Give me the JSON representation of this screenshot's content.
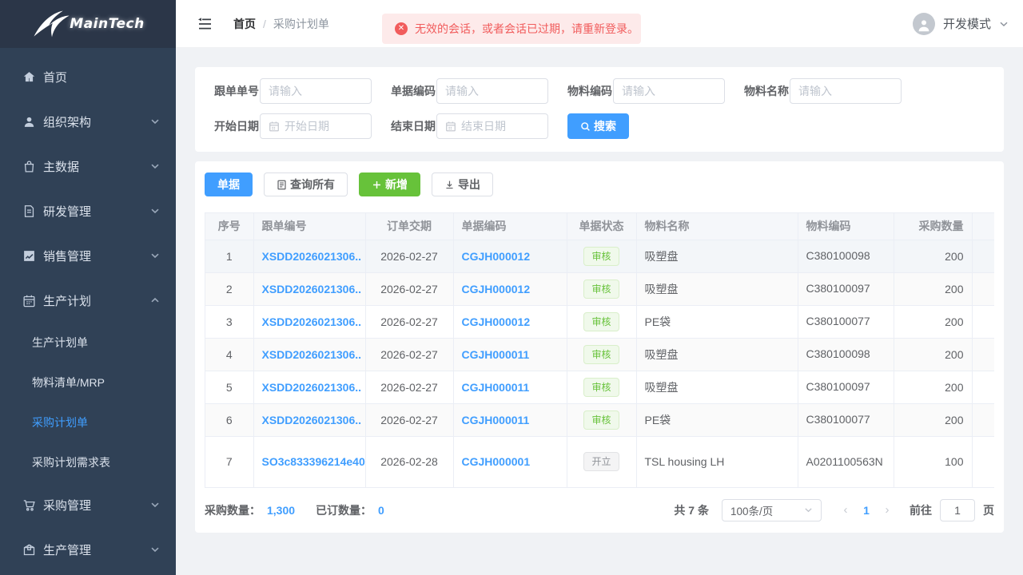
{
  "sidebar": {
    "logo_text": "MainTech",
    "menu": [
      {
        "label": "首页",
        "icon": "home-icon"
      },
      {
        "label": "组织架构",
        "icon": "user-icon",
        "chevron": "down"
      },
      {
        "label": "主数据",
        "icon": "bag-icon",
        "chevron": "down"
      },
      {
        "label": "研发管理",
        "icon": "document-icon",
        "chevron": "down"
      },
      {
        "label": "销售管理",
        "icon": "chart-icon",
        "chevron": "down"
      },
      {
        "label": "生产计划",
        "icon": "calendar-icon",
        "chevron": "up",
        "expanded": true
      },
      {
        "label": "采购管理",
        "icon": "cart-icon",
        "chevron": "down"
      },
      {
        "label": "生产管理",
        "icon": "box-icon",
        "chevron": "down"
      }
    ],
    "production_submenu": [
      {
        "label": "生产计划单",
        "active": false
      },
      {
        "label": "物料清单/MRP",
        "active": false
      },
      {
        "label": "采购计划单",
        "active": true
      },
      {
        "label": "采购计划需求表",
        "active": false
      }
    ]
  },
  "header": {
    "breadcrumb": {
      "home": "首页",
      "separator": "/",
      "current": "采购计划单"
    },
    "alert_text": "无效的会话，或者会话已过期，请重新登录。",
    "user_name": "开发模式"
  },
  "search": {
    "fields": [
      {
        "label": "跟单单号",
        "placeholder": "请输入"
      },
      {
        "label": "单据编码",
        "placeholder": "请输入"
      },
      {
        "label": "物料编码",
        "placeholder": "请输入"
      },
      {
        "label": "物料名称",
        "placeholder": "请输入"
      }
    ],
    "date_fields": [
      {
        "label": "开始日期",
        "placeholder": "开始日期"
      },
      {
        "label": "结束日期",
        "placeholder": "结束日期"
      }
    ],
    "search_button": "搜索"
  },
  "toolbar": {
    "document_button": "单据",
    "query_all_button": "查询所有",
    "add_button": "新增",
    "export_button": "导出"
  },
  "table": {
    "columns": [
      "序号",
      "跟单编号",
      "订单交期",
      "单据编码",
      "单据状态",
      "物料名称",
      "物料编码",
      "采购数量"
    ],
    "rows": [
      {
        "no": "1",
        "order": "XSDD2026021306..",
        "date": "2026-02-27",
        "doc": "CGJH000012",
        "status": "审核",
        "status_type": "success",
        "material": "吸塑盘",
        "code": "C380100098",
        "qty": "200"
      },
      {
        "no": "2",
        "order": "XSDD2026021306..",
        "date": "2026-02-27",
        "doc": "CGJH000012",
        "status": "审核",
        "status_type": "success",
        "material": "吸塑盘",
        "code": "C380100097",
        "qty": "200"
      },
      {
        "no": "3",
        "order": "XSDD2026021306..",
        "date": "2026-02-27",
        "doc": "CGJH000012",
        "status": "审核",
        "status_type": "success",
        "material": "PE袋",
        "code": "C380100077",
        "qty": "200"
      },
      {
        "no": "4",
        "order": "XSDD2026021306..",
        "date": "2026-02-27",
        "doc": "CGJH000011",
        "status": "审核",
        "status_type": "success",
        "material": "吸塑盘",
        "code": "C380100098",
        "qty": "200"
      },
      {
        "no": "5",
        "order": "XSDD2026021306..",
        "date": "2026-02-27",
        "doc": "CGJH000011",
        "status": "审核",
        "status_type": "success",
        "material": "吸塑盘",
        "code": "C380100097",
        "qty": "200"
      },
      {
        "no": "6",
        "order": "XSDD2026021306..",
        "date": "2026-02-27",
        "doc": "CGJH000011",
        "status": "审核",
        "status_type": "success",
        "material": "PE袋",
        "code": "C380100077",
        "qty": "200"
      },
      {
        "no": "7",
        "order": "SO3c833396214e40",
        "date": "2026-02-28",
        "doc": "CGJH000001",
        "status": "开立",
        "status_type": "info",
        "material": "TSL housing LH",
        "code": "A0201100563N",
        "qty": "100",
        "tall": true
      }
    ]
  },
  "footer": {
    "purchase_qty_label": "采购数量：",
    "purchase_qty": "1,300",
    "ordered_qty_label": "已订数量：",
    "ordered_qty": "0",
    "total_text": "共 7 条",
    "page_size": "100条/页",
    "current_page": "1",
    "goto_label": "前往",
    "goto_value": "1",
    "page_suffix": "页"
  },
  "colors": {
    "primary": "#409eff",
    "success": "#67c23a",
    "danger": "#f15c5c",
    "sidebar_bg": "#304156",
    "logo_bg": "#2b3648"
  }
}
